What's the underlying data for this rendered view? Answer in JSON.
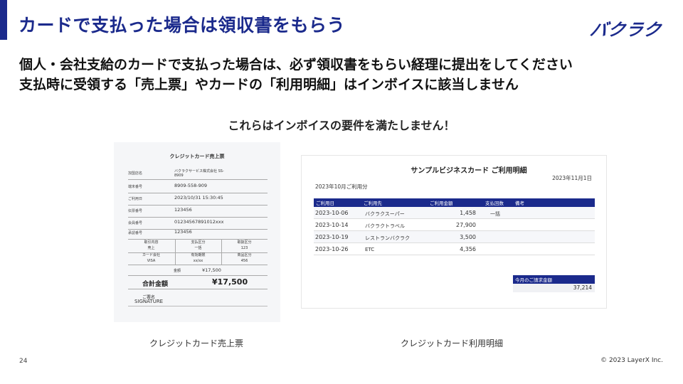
{
  "title": "カードで支払った場合は領収書をもらう",
  "logo": "バクラク",
  "lead": {
    "line1": "個人・会社支給のカードで支払った場合は、必ず領収書をもらい経理に提出をしてください",
    "line2": "支払時に受領する「売上票」やカードの「利用明細」はインボイスに該当しません"
  },
  "note": "これらはインボイスの要件を満たしません！",
  "receipt": {
    "title": "クレジットカード売上票",
    "rows": [
      {
        "key": "加盟店名",
        "value": "バクラクサービス株式会社 SS-8909"
      },
      {
        "key": "端末番号",
        "value": "8909-558-909"
      },
      {
        "key": "ご利用日",
        "value": "2023/10/31  15:30:45"
      },
      {
        "key": "伝票番号",
        "value": "123456"
      },
      {
        "key": "会員番号",
        "value": "01234567891012xxx"
      },
      {
        "key": "承認番号",
        "value": "123456"
      }
    ],
    "grid": [
      [
        "取引内容",
        "支払区分",
        "取扱区分"
      ],
      [
        "売上",
        "一括",
        "123"
      ],
      [
        "カード会社",
        "有効期限",
        "商品区分"
      ],
      [
        "VISA",
        "xx/xx",
        "456"
      ]
    ],
    "amount_label": "金額",
    "amount_value": "¥17,500",
    "total_label": "合計金額",
    "total_value": "¥17,500",
    "sign_label": "ご署名",
    "sign_value": "SIGNATURE"
  },
  "statement": {
    "title": "サンプルビジネスカード  ご利用明細",
    "date": "2023年11月1日",
    "month": "2023年10月ご利用分",
    "headers": [
      "ご利用日",
      "ご利用先",
      "ご利用金額",
      "支払回数",
      "備考"
    ],
    "rows": [
      {
        "date": "2023-10-06",
        "name": "バクラクスーパー",
        "amount": "1,458",
        "count": "一括"
      },
      {
        "date": "2023-10-14",
        "name": "バクラクトラベル",
        "amount": "27,900",
        "count": ""
      },
      {
        "date": "2023-10-19",
        "name": "レストランバクラク",
        "amount": "3,500",
        "count": ""
      },
      {
        "date": "2023-10-26",
        "name": "ETC",
        "amount": "4,356",
        "count": ""
      }
    ],
    "summary_label": "今月のご請求金額",
    "summary_value": "37,214"
  },
  "captions": {
    "receipt": "クレジットカード売上票",
    "statement": "クレジットカード利用明細"
  },
  "footer": {
    "page": "24",
    "copyright": "© 2023 LayerX Inc."
  },
  "colors": {
    "accent": "#1b2a8c"
  }
}
